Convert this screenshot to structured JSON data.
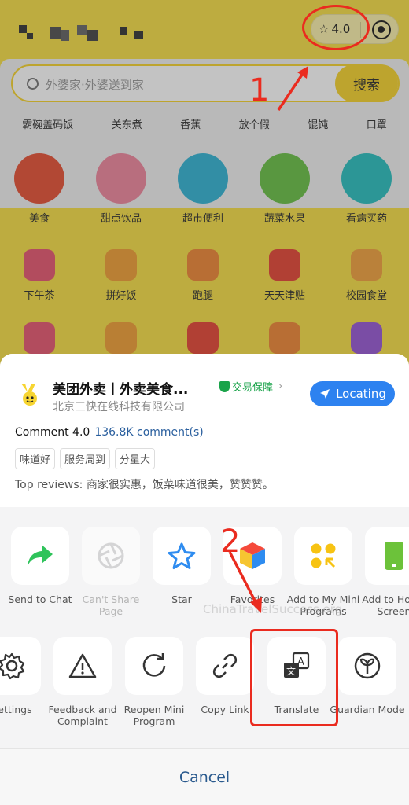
{
  "header": {
    "rating": "4.0"
  },
  "search": {
    "placeholder": "外婆家·外婆送到家",
    "button": "搜索",
    "quick_tags": [
      "霸碗盖码饭",
      "关东煮",
      "香蕉",
      "放个假",
      "馄饨",
      "口罩"
    ]
  },
  "categories": [
    {
      "label": "美食",
      "color": "#e8553a"
    },
    {
      "label": "甜点饮品",
      "color": "#f08aa0"
    },
    {
      "label": "超市便利",
      "color": "#37b6d6"
    },
    {
      "label": "蔬菜水果",
      "color": "#6cc24a"
    },
    {
      "label": "看病买药",
      "color": "#2fc1c1"
    },
    {
      "label": "下午茶",
      "color": "#e85b73"
    },
    {
      "label": "拼好饭",
      "color": "#f2a13a"
    },
    {
      "label": "跑腿",
      "color": "#f08a3a"
    },
    {
      "label": "天天津贴",
      "color": "#e64a3a"
    },
    {
      "label": "校园食堂",
      "color": "#f3a442"
    }
  ],
  "sheet": {
    "app_title": "美团外卖丨外卖美食...",
    "guarantee": "交易保障",
    "company": "北京三快在线科技有限公司",
    "locating": "Locating",
    "comment_label": "Comment 4.0",
    "comment_count": "136.8K comment(s)",
    "tags": [
      "味道好",
      "服务周到",
      "分量大"
    ],
    "top_reviews": "Top reviews: 商家很实惠，饭菜味道很美，赞赞赞。"
  },
  "actions_row1": [
    {
      "label": "Send to Chat",
      "icon": "share-arrow-icon"
    },
    {
      "label": "Can't Share Page",
      "icon": "aperture-icon"
    },
    {
      "label": "Star",
      "icon": "star-icon"
    },
    {
      "label": "Favorites",
      "icon": "cube-icon"
    },
    {
      "label": "Add to My Mini Programs",
      "icon": "grid-dots-icon"
    },
    {
      "label": "Add to Home Screen",
      "icon": "phone-icon"
    }
  ],
  "actions_row2": [
    {
      "label": "Settings",
      "icon": "gear-icon"
    },
    {
      "label": "Feedback and Complaint",
      "icon": "warning-icon"
    },
    {
      "label": "Reopen Mini Program",
      "icon": "reload-icon"
    },
    {
      "label": "Copy Link",
      "icon": "link-icon"
    },
    {
      "label": "Translate",
      "icon": "translate-icon"
    },
    {
      "label": "Guardian Mode",
      "icon": "sprout-icon"
    }
  ],
  "cancel": "Cancel",
  "watermark": "ChinaTravelSuccess.org",
  "annotations": {
    "step1": "1",
    "step2": "2",
    "color": "#ea2b1f"
  }
}
